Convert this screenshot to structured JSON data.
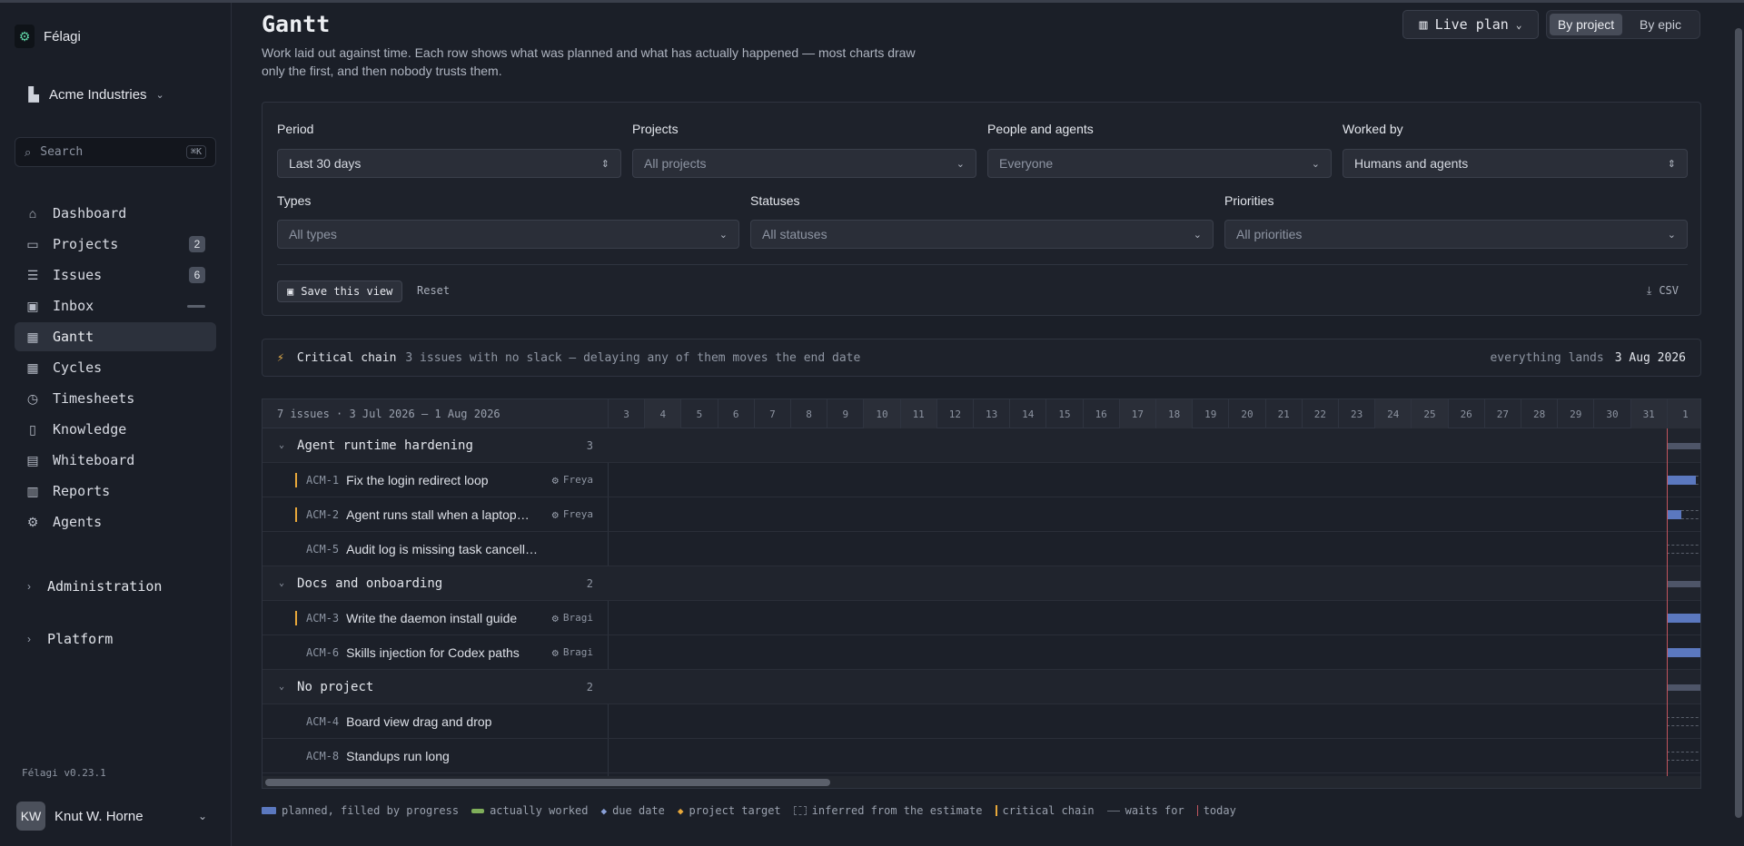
{
  "sidebar": {
    "brand": "Félagi",
    "org": "Acme Industries",
    "search": {
      "placeholder": "Search",
      "shortcut": "⌘K"
    },
    "items": [
      {
        "label": "Dashboard",
        "icon": "home-icon",
        "glyph": "⌂"
      },
      {
        "label": "Projects",
        "icon": "folder-icon",
        "glyph": "▭",
        "badge": "2"
      },
      {
        "label": "Issues",
        "icon": "stack-icon",
        "glyph": "☰",
        "badge": "6"
      },
      {
        "label": "Inbox",
        "icon": "inbox-icon",
        "glyph": "▣"
      },
      {
        "label": "Gantt",
        "icon": "calendar-icon",
        "glyph": "▦"
      },
      {
        "label": "Cycles",
        "icon": "calendar-icon",
        "glyph": "▦"
      },
      {
        "label": "Timesheets",
        "icon": "clock-icon",
        "glyph": "◷"
      },
      {
        "label": "Knowledge",
        "icon": "book-icon",
        "glyph": "▯"
      },
      {
        "label": "Whiteboard",
        "icon": "whiteboard-icon",
        "glyph": "▤"
      },
      {
        "label": "Reports",
        "icon": "bar-chart-icon",
        "glyph": "▥"
      },
      {
        "label": "Agents",
        "icon": "agent-icon",
        "glyph": "⚙"
      }
    ],
    "sections": [
      "Administration",
      "Platform"
    ],
    "version": "Félagi v0.23.1",
    "user": {
      "initials": "KW",
      "name": "Knut W. Horne"
    }
  },
  "header": {
    "title": "Gantt",
    "description": "Work laid out against time. Each row shows what was planned and what has actually happened — most charts draw only the first, and then nobody trusts them.",
    "live_plan": "Live plan",
    "view_modes": [
      "By project",
      "By epic"
    ]
  },
  "filters": {
    "period": {
      "label": "Period",
      "value": "Last 30 days"
    },
    "projects": {
      "label": "Projects",
      "value": "All projects"
    },
    "people": {
      "label": "People and agents",
      "value": "Everyone"
    },
    "worked_by": {
      "label": "Worked by",
      "value": "Humans and agents"
    },
    "types": {
      "label": "Types",
      "value": "All types"
    },
    "statuses": {
      "label": "Statuses",
      "value": "All statuses"
    },
    "priorities": {
      "label": "Priorities",
      "value": "All priorities"
    },
    "save_label": "Save this view",
    "reset_label": "Reset",
    "csv_label": "CSV"
  },
  "critical": {
    "title": "Critical chain",
    "description": "3 issues with no slack — delaying any of them moves the end date",
    "lands_label": "everything lands",
    "lands_date": "3 Aug 2026"
  },
  "gantt": {
    "summary": "7 issues · 3 Jul 2026 – 1 Aug 2026",
    "days": [
      "3",
      "4",
      "5",
      "6",
      "7",
      "8",
      "9",
      "10",
      "11",
      "12",
      "13",
      "14",
      "15",
      "16",
      "17",
      "18",
      "19",
      "20",
      "21",
      "22",
      "23",
      "24",
      "25",
      "26",
      "27",
      "28",
      "29",
      "30",
      "31",
      "1"
    ],
    "weekend_index": [
      1,
      7,
      8,
      14,
      15,
      21,
      22,
      28,
      29
    ],
    "groups": [
      {
        "name": "Agent runtime hardening",
        "count": "3",
        "issues": [
          {
            "key": "ACM-1",
            "title": "Fix the login redirect loop",
            "assignee": "Freya",
            "critical": true,
            "planned_progress": 0.8
          },
          {
            "key": "ACM-2",
            "title": "Agent runs stall when a laptop…",
            "assignee": "Freya",
            "critical": true,
            "planned_progress": 0.4
          },
          {
            "key": "ACM-5",
            "title": "Audit log is missing task cancellations",
            "assignee": "",
            "critical": false,
            "planned_progress": 0
          }
        ]
      },
      {
        "name": "Docs and onboarding",
        "count": "2",
        "issues": [
          {
            "key": "ACM-3",
            "title": "Write the daemon install guide",
            "assignee": "Bragi",
            "critical": true,
            "planned_progress": 1
          },
          {
            "key": "ACM-6",
            "title": "Skills injection for Codex paths",
            "assignee": "Bragi",
            "critical": false,
            "planned_progress": 1
          }
        ]
      },
      {
        "name": "No project",
        "count": "2",
        "issues": [
          {
            "key": "ACM-4",
            "title": "Board view drag and drop",
            "assignee": "",
            "critical": false,
            "planned_progress": 0
          },
          {
            "key": "ACM-8",
            "title": "Standups run long",
            "assignee": "",
            "critical": false,
            "planned_progress": 0
          }
        ]
      }
    ]
  },
  "legend": [
    "planned, filled by progress",
    "actually worked",
    "due date",
    "project target",
    "inferred from the estimate",
    "critical chain",
    "waits for",
    "today"
  ],
  "colors": {
    "planned": "#5b78bf",
    "worked": "#7fae5a",
    "due": "#8aa0d8",
    "target": "#e8a83a",
    "critical": "#e8a83a",
    "today": "#c1555e"
  }
}
